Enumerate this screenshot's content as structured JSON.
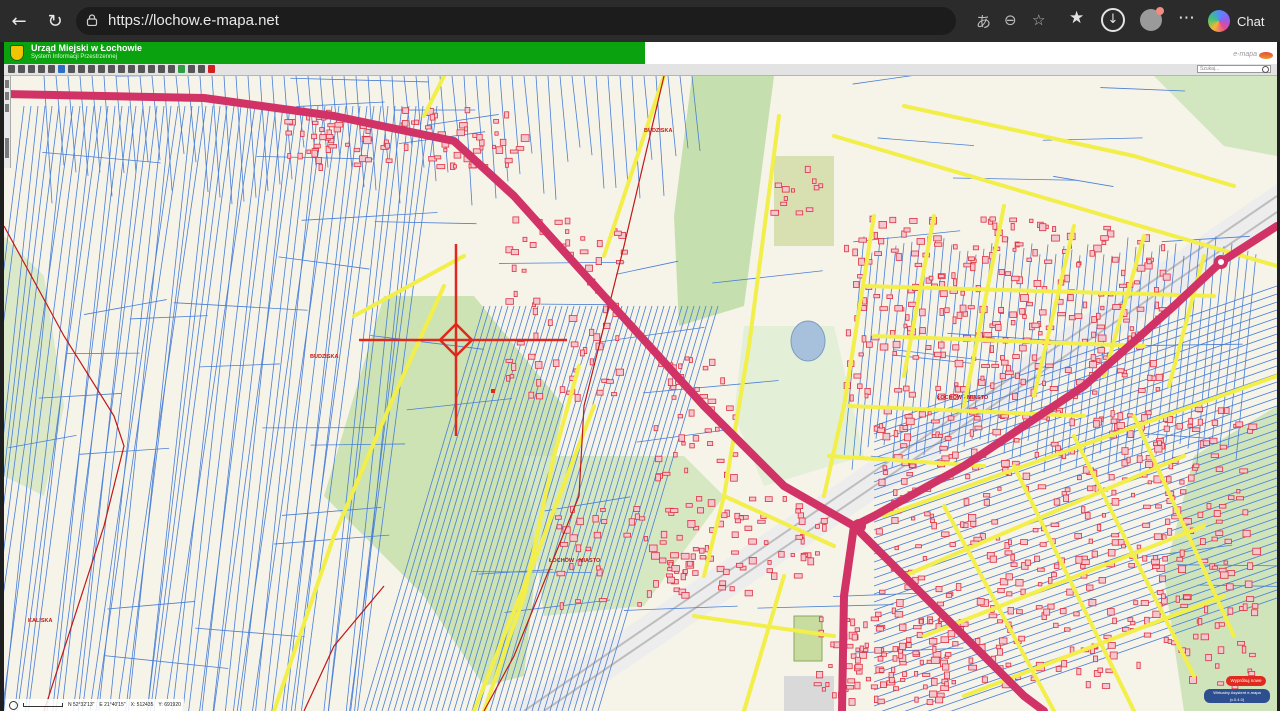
{
  "browser": {
    "url": "https://lochow.e-mapa.net",
    "chat_label": "Chat"
  },
  "site": {
    "title": "Urząd Miejski w Łochowie",
    "subtitle": "System Informacji Przestrzennej",
    "brand": "e-mapa",
    "search_placeholder": "Szukaj..."
  },
  "map": {
    "labels": {
      "budziska_top": "BUDZISKA",
      "budziska_mid": "BUDZISKA",
      "lochow_miasto_east": "ŁOCHÓW - MIASTO",
      "lochow_miasto_south": "ŁOCHÓW - MIASTO",
      "kaliska": "KALISKA"
    },
    "status": {
      "coord_a": "N 52°32'13\"",
      "coord_b": "E 21°40'15\"",
      "x": "X: 512435",
      "y": "Y: 691920"
    },
    "buttons": {
      "report": "Wypróbuj nowe",
      "assistant_line1": "Wirtualny Asystent e-mapa",
      "assistant_line2": "(v.0.4.0)"
    }
  },
  "colors": {
    "road_main": "#d23366",
    "road_local": "#f2ee4a",
    "parcel_line": "#4a7fd6",
    "building": "#e03040",
    "boundary": "#c01818",
    "green_area": "#c4dca8",
    "map_bg": "#f6f3e9",
    "header_green": "#0aa20e"
  }
}
